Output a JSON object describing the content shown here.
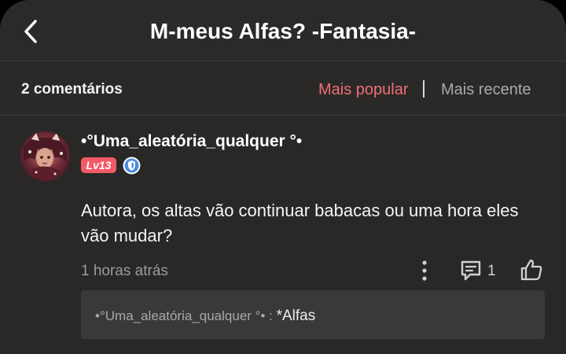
{
  "header": {
    "title": "M-meus Alfas? -Fantasia-"
  },
  "sort": {
    "count_label": "2 comentários",
    "popular_label": "Mais popular",
    "recent_label": "Mais recente",
    "active": "popular"
  },
  "comment": {
    "username": "•°Uma_aleatória_qualquer °•",
    "level": "Lv13",
    "text": "Autora, os altas vão continuar babacas ou uma hora eles vão mudar?",
    "time": "1 horas atrás",
    "reply_count": "1",
    "reply": {
      "author": "•°Uma_aleatória_qualquer °•",
      "separator": " : ",
      "text": "*Alfas"
    }
  },
  "colors": {
    "accent": "#f26d78",
    "level_badge": "#f35a67",
    "role_badge": "#4d8de0",
    "background": "#292827"
  }
}
